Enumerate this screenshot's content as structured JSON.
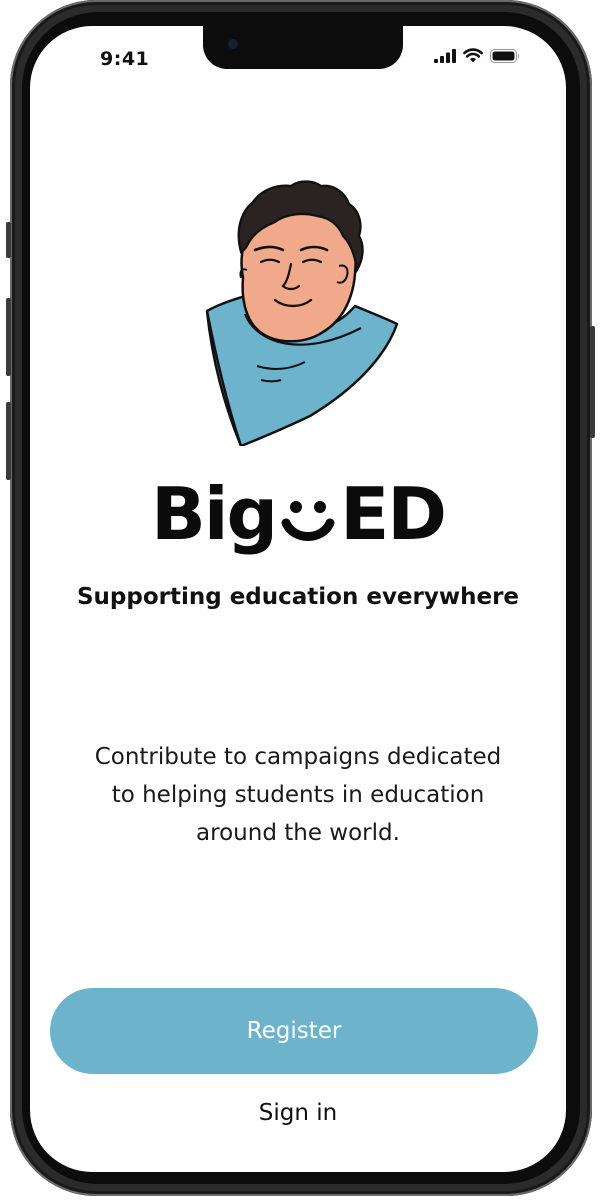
{
  "status_bar": {
    "time": "9:41",
    "icons": [
      "signal-icon",
      "wifi-icon",
      "battery-icon"
    ]
  },
  "illustration": {
    "name": "mascot-avatar",
    "colors": {
      "skin": "#f0a98a",
      "shirt": "#6db3cb",
      "hair": "#2b2222",
      "outline": "#111111"
    }
  },
  "brand": {
    "logo_part1": "Big",
    "logo_part2": "ED",
    "tagline": "Supporting education everywhere"
  },
  "description": "Contribute to campaigns dedicated to helping students in education around the world.",
  "actions": {
    "register_label": "Register",
    "signin_label": "Sign in"
  },
  "colors": {
    "accent": "#6db3cb",
    "text": "#111111",
    "background": "#ffffff"
  }
}
